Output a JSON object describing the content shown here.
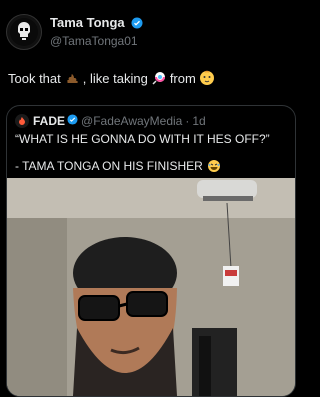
{
  "tweet": {
    "author": {
      "display_name": "Tama Tonga",
      "handle": "@TamaTonga01",
      "verified": true
    },
    "text_prefix": "Took that",
    "text_middle": ", like taking",
    "text_suffix": "from",
    "emojis": [
      "poop-emoji",
      "lollipop-emoji",
      "baby-emoji"
    ]
  },
  "quote": {
    "author": {
      "display_name": "FADE",
      "handle": "@FadeAwayMedia",
      "time": "1d",
      "verified": true
    },
    "line1": "“WHAT IS HE GONNA DO WITH IT HES OFF?”",
    "line2": "- TAMA TONGA ON HIS FINISHER",
    "line2_emoji": "laughing-emoji",
    "media": {
      "type": "photo",
      "description_icon": "selfie-photo"
    }
  },
  "colors": {
    "background": "#000000",
    "text": "#e7e9ea",
    "muted": "#71767b",
    "verified": "#1d9bf0",
    "border": "#2f3336"
  }
}
